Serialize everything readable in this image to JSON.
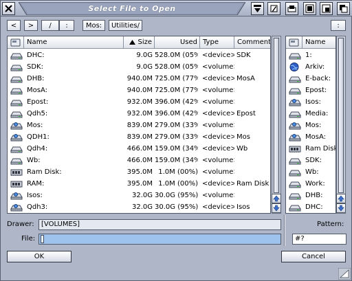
{
  "window": {
    "title": "Select File to Open"
  },
  "pathbar": {
    "back": "<",
    "forward": ">",
    "root": "/",
    "parent": ":",
    "crumbs": [
      "Mos:",
      "Utilities/"
    ],
    "right_button": ":"
  },
  "main_list": {
    "columns": [
      "Name",
      "Size",
      "Used",
      "Type",
      "Comment"
    ],
    "rows": [
      {
        "icon": "drive",
        "name": "DHC:",
        "size": "9.0G",
        "used": "528.0M (05%)",
        "type": "<device>",
        "comment": "SDK"
      },
      {
        "icon": "drive",
        "name": "SDK:",
        "size": "9.0G",
        "used": "528.0M (05%)",
        "type": "<volume>",
        "comment": ""
      },
      {
        "icon": "drive",
        "name": "DHB:",
        "size": "940.0M",
        "used": "725.0M (77%)",
        "type": "<device>",
        "comment": "MosA"
      },
      {
        "icon": "drive",
        "name": "MosA:",
        "size": "940.0M",
        "used": "725.0M (77%)",
        "type": "<volume>",
        "comment": ""
      },
      {
        "icon": "drive",
        "name": "Epost:",
        "size": "932.0M",
        "used": "396.0M (42%)",
        "type": "<volume>",
        "comment": ""
      },
      {
        "icon": "drive",
        "name": "Qdh5:",
        "size": "932.0M",
        "used": "396.0M (42%)",
        "type": "<device>",
        "comment": "Epost"
      },
      {
        "icon": "mos",
        "name": "Mos:",
        "size": "839.0M",
        "used": "279.0M (33%)",
        "type": "<volume>",
        "comment": ""
      },
      {
        "icon": "mos",
        "name": "QDH1:",
        "size": "839.0M",
        "used": "279.0M (33%)",
        "type": "<device>",
        "comment": "Mos"
      },
      {
        "icon": "drive",
        "name": "Qdh4:",
        "size": "466.0M",
        "used": "159.0M (34%)",
        "type": "<device>",
        "comment": "Wb"
      },
      {
        "icon": "drive",
        "name": "Wb:",
        "size": "466.0M",
        "used": "159.0M (34%)",
        "type": "<volume>",
        "comment": ""
      },
      {
        "icon": "ram",
        "name": "Ram Disk:",
        "size": "395.0M",
        "used": "1.0M (00%)",
        "type": "<volume>",
        "comment": ""
      },
      {
        "icon": "ram",
        "name": "RAM:",
        "size": "395.0M",
        "used": "1.0M (00%)",
        "type": "<device>",
        "comment": "Ram Disk"
      },
      {
        "icon": "mos",
        "name": "Isos:",
        "size": "32.0G",
        "used": "30.0G (95%)",
        "type": "<volume>",
        "comment": ""
      },
      {
        "icon": "mos",
        "name": "Qdh3:",
        "size": "32.0G",
        "used": "30.0G (95%)",
        "type": "<device>",
        "comment": "Isos"
      }
    ]
  },
  "side_list": {
    "column": "Name",
    "rows": [
      {
        "icon": "drive",
        "name": "1:"
      },
      {
        "icon": "globe",
        "name": "Arkiv:"
      },
      {
        "icon": "drive",
        "name": "E-back:"
      },
      {
        "icon": "drive",
        "name": "Epost:"
      },
      {
        "icon": "mos",
        "name": "Isos:"
      },
      {
        "icon": "drive",
        "name": "Media:"
      },
      {
        "icon": "mos",
        "name": "Mos:"
      },
      {
        "icon": "mos",
        "name": "MosA:"
      },
      {
        "icon": "ram",
        "name": "Ram Disk:"
      },
      {
        "icon": "drive",
        "name": "SDK:"
      },
      {
        "icon": "drive",
        "name": "Wb:"
      },
      {
        "icon": "drive",
        "name": "Work:"
      },
      {
        "icon": "drive",
        "name": "DHB:"
      },
      {
        "icon": "drive",
        "name": "DHC:"
      }
    ]
  },
  "drawer": {
    "label": "Drawer:",
    "value": "[VOLUMES]"
  },
  "file": {
    "label": "File:",
    "value": ""
  },
  "pattern": {
    "label": "Pattern:",
    "value": "#?"
  },
  "buttons": {
    "ok": "OK",
    "cancel": "Cancel"
  },
  "colors": {
    "window_bg": "#aeb6c8",
    "file_field": "#9ec4ee",
    "arrow_blue": "#3a70d0"
  }
}
